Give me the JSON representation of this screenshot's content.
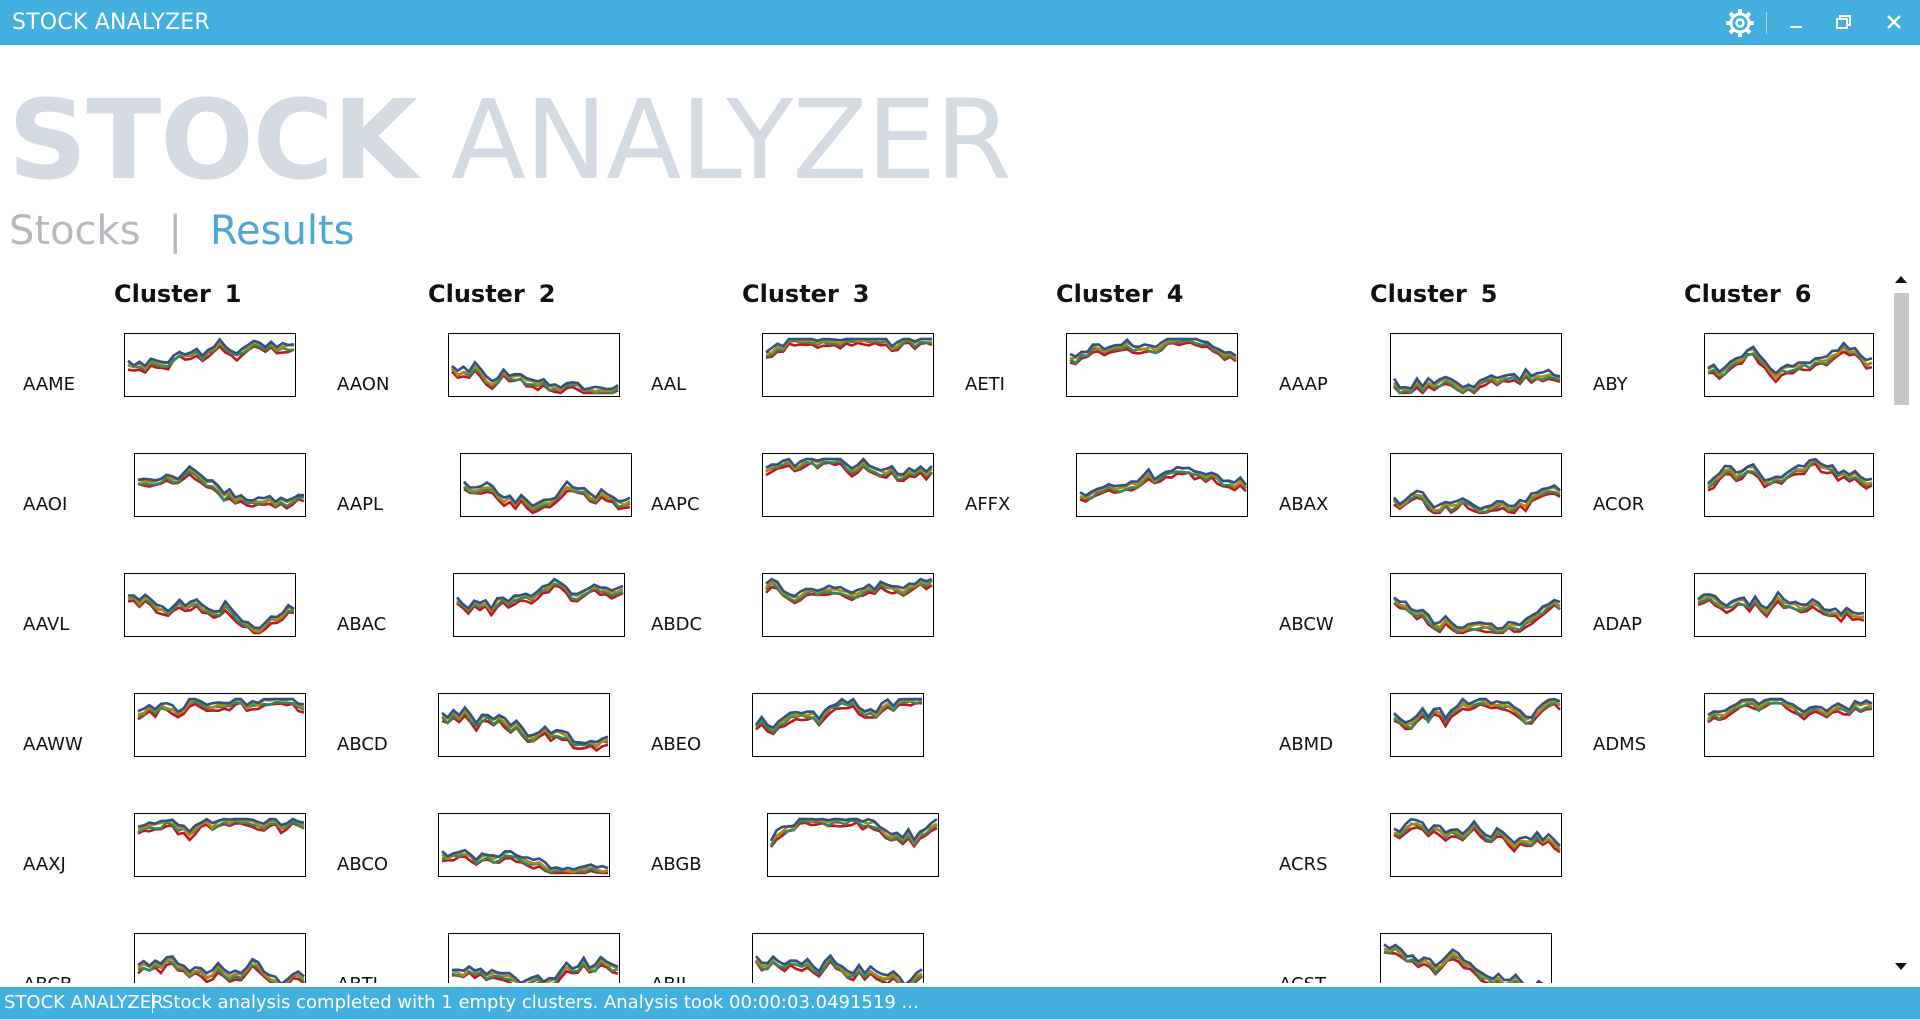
{
  "window": {
    "title": "STOCK ANALYZER"
  },
  "hero": {
    "bold": "STOCK",
    "light": "ANALYZER"
  },
  "nav": {
    "stocks": "Stocks",
    "separator": "|",
    "results": "Results"
  },
  "status": {
    "app": "STOCK ANALYZER",
    "message": "Stock analysis completed with 1 empty clusters. Analysis took 00:00:03.0491519 ..."
  },
  "colors": {
    "accent": "#44b0e0",
    "series": [
      "#c8121d",
      "#2e8b57",
      "#b08a10",
      "#2f4f8f"
    ]
  },
  "icons": {
    "settings": "gear-icon",
    "minimize": "minimize-icon",
    "restore": "restore-icon",
    "close": "close-icon"
  },
  "clusters": [
    {
      "label": "Cluster",
      "number": "1",
      "stocks": [
        "AAME",
        "AAOI",
        "AAVL",
        "AAWW",
        "AAXJ",
        "ABCB"
      ]
    },
    {
      "label": "Cluster",
      "number": "2",
      "stocks": [
        "AAON",
        "AAPL",
        "ABAC",
        "ABCD",
        "ABCO",
        "ABTL"
      ]
    },
    {
      "label": "Cluster",
      "number": "3",
      "stocks": [
        "AAL",
        "AAPC",
        "ABDC",
        "ABEO",
        "ABGB",
        "ABIL"
      ]
    },
    {
      "label": "Cluster",
      "number": "4",
      "stocks": [
        "AETI",
        "AFFX"
      ]
    },
    {
      "label": "Cluster",
      "number": "5",
      "stocks": [
        "AAAP",
        "ABAX",
        "ABCW",
        "ABMD",
        "ACRS",
        "ACST"
      ]
    },
    {
      "label": "Cluster",
      "number": "6",
      "stocks": [
        "ABY",
        "ACOR",
        "ADAP",
        "ADMS"
      ]
    }
  ]
}
